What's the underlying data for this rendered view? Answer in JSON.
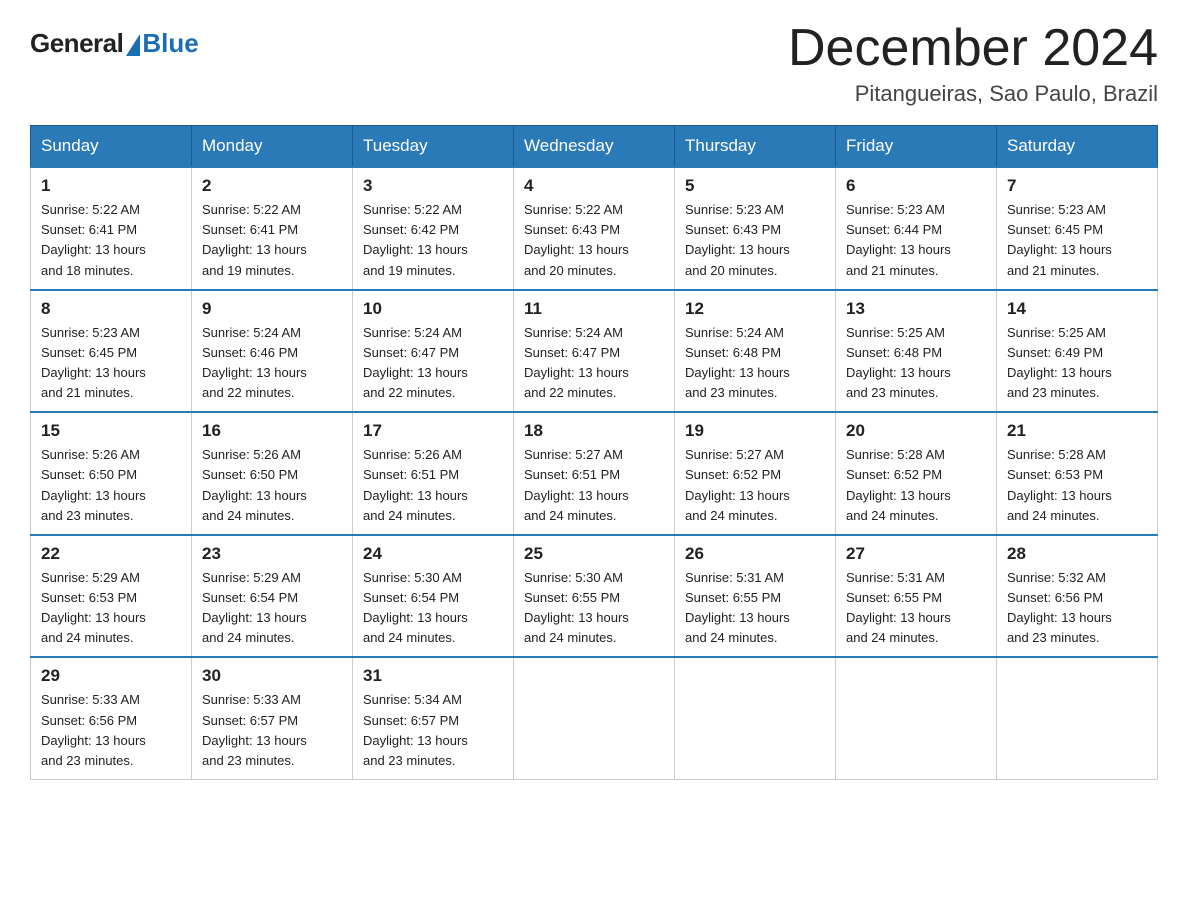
{
  "logo": {
    "general": "General",
    "blue": "Blue"
  },
  "title": "December 2024",
  "location": "Pitangueiras, Sao Paulo, Brazil",
  "days_of_week": [
    "Sunday",
    "Monday",
    "Tuesday",
    "Wednesday",
    "Thursday",
    "Friday",
    "Saturday"
  ],
  "weeks": [
    [
      {
        "day": "1",
        "sunrise": "5:22 AM",
        "sunset": "6:41 PM",
        "daylight": "13 hours and 18 minutes."
      },
      {
        "day": "2",
        "sunrise": "5:22 AM",
        "sunset": "6:41 PM",
        "daylight": "13 hours and 19 minutes."
      },
      {
        "day": "3",
        "sunrise": "5:22 AM",
        "sunset": "6:42 PM",
        "daylight": "13 hours and 19 minutes."
      },
      {
        "day": "4",
        "sunrise": "5:22 AM",
        "sunset": "6:43 PM",
        "daylight": "13 hours and 20 minutes."
      },
      {
        "day": "5",
        "sunrise": "5:23 AM",
        "sunset": "6:43 PM",
        "daylight": "13 hours and 20 minutes."
      },
      {
        "day": "6",
        "sunrise": "5:23 AM",
        "sunset": "6:44 PM",
        "daylight": "13 hours and 21 minutes."
      },
      {
        "day": "7",
        "sunrise": "5:23 AM",
        "sunset": "6:45 PM",
        "daylight": "13 hours and 21 minutes."
      }
    ],
    [
      {
        "day": "8",
        "sunrise": "5:23 AM",
        "sunset": "6:45 PM",
        "daylight": "13 hours and 21 minutes."
      },
      {
        "day": "9",
        "sunrise": "5:24 AM",
        "sunset": "6:46 PM",
        "daylight": "13 hours and 22 minutes."
      },
      {
        "day": "10",
        "sunrise": "5:24 AM",
        "sunset": "6:47 PM",
        "daylight": "13 hours and 22 minutes."
      },
      {
        "day": "11",
        "sunrise": "5:24 AM",
        "sunset": "6:47 PM",
        "daylight": "13 hours and 22 minutes."
      },
      {
        "day": "12",
        "sunrise": "5:24 AM",
        "sunset": "6:48 PM",
        "daylight": "13 hours and 23 minutes."
      },
      {
        "day": "13",
        "sunrise": "5:25 AM",
        "sunset": "6:48 PM",
        "daylight": "13 hours and 23 minutes."
      },
      {
        "day": "14",
        "sunrise": "5:25 AM",
        "sunset": "6:49 PM",
        "daylight": "13 hours and 23 minutes."
      }
    ],
    [
      {
        "day": "15",
        "sunrise": "5:26 AM",
        "sunset": "6:50 PM",
        "daylight": "13 hours and 23 minutes."
      },
      {
        "day": "16",
        "sunrise": "5:26 AM",
        "sunset": "6:50 PM",
        "daylight": "13 hours and 24 minutes."
      },
      {
        "day": "17",
        "sunrise": "5:26 AM",
        "sunset": "6:51 PM",
        "daylight": "13 hours and 24 minutes."
      },
      {
        "day": "18",
        "sunrise": "5:27 AM",
        "sunset": "6:51 PM",
        "daylight": "13 hours and 24 minutes."
      },
      {
        "day": "19",
        "sunrise": "5:27 AM",
        "sunset": "6:52 PM",
        "daylight": "13 hours and 24 minutes."
      },
      {
        "day": "20",
        "sunrise": "5:28 AM",
        "sunset": "6:52 PM",
        "daylight": "13 hours and 24 minutes."
      },
      {
        "day": "21",
        "sunrise": "5:28 AM",
        "sunset": "6:53 PM",
        "daylight": "13 hours and 24 minutes."
      }
    ],
    [
      {
        "day": "22",
        "sunrise": "5:29 AM",
        "sunset": "6:53 PM",
        "daylight": "13 hours and 24 minutes."
      },
      {
        "day": "23",
        "sunrise": "5:29 AM",
        "sunset": "6:54 PM",
        "daylight": "13 hours and 24 minutes."
      },
      {
        "day": "24",
        "sunrise": "5:30 AM",
        "sunset": "6:54 PM",
        "daylight": "13 hours and 24 minutes."
      },
      {
        "day": "25",
        "sunrise": "5:30 AM",
        "sunset": "6:55 PM",
        "daylight": "13 hours and 24 minutes."
      },
      {
        "day": "26",
        "sunrise": "5:31 AM",
        "sunset": "6:55 PM",
        "daylight": "13 hours and 24 minutes."
      },
      {
        "day": "27",
        "sunrise": "5:31 AM",
        "sunset": "6:55 PM",
        "daylight": "13 hours and 24 minutes."
      },
      {
        "day": "28",
        "sunrise": "5:32 AM",
        "sunset": "6:56 PM",
        "daylight": "13 hours and 23 minutes."
      }
    ],
    [
      {
        "day": "29",
        "sunrise": "5:33 AM",
        "sunset": "6:56 PM",
        "daylight": "13 hours and 23 minutes."
      },
      {
        "day": "30",
        "sunrise": "5:33 AM",
        "sunset": "6:57 PM",
        "daylight": "13 hours and 23 minutes."
      },
      {
        "day": "31",
        "sunrise": "5:34 AM",
        "sunset": "6:57 PM",
        "daylight": "13 hours and 23 minutes."
      },
      null,
      null,
      null,
      null
    ]
  ],
  "labels": {
    "sunrise": "Sunrise:",
    "sunset": "Sunset:",
    "daylight": "Daylight:"
  }
}
